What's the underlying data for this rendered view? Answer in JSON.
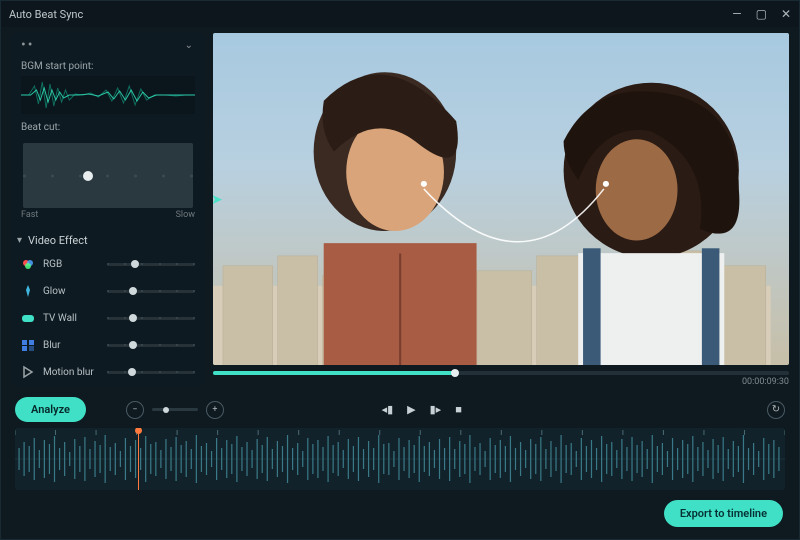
{
  "window": {
    "title": "Auto Beat Sync"
  },
  "bgm": {
    "label": "BGM start point:",
    "beat_cut_label": "Beat cut:",
    "beat_cut_min": "Fast",
    "beat_cut_max": "Slow",
    "beat_cut_value_pct": 38
  },
  "effects": {
    "section_label": "Video Effect",
    "items": [
      {
        "name": "RGB",
        "icon": "rgb-icon",
        "value_pct": 32
      },
      {
        "name": "Glow",
        "icon": "glow-icon",
        "value_pct": 30
      },
      {
        "name": "TV Wall",
        "icon": "tvwall-icon",
        "value_pct": 30
      },
      {
        "name": "Blur",
        "icon": "blur-icon",
        "value_pct": 30
      },
      {
        "name": "Motion blur",
        "icon": "motionblur-icon",
        "value_pct": 28
      }
    ]
  },
  "preview": {
    "progress_pct": 42,
    "timecode": "00:00:09:30"
  },
  "controls": {
    "analyze_label": "Analyze",
    "zoom_pct": 30
  },
  "timeline": {
    "playhead_pct": 16
  },
  "footer": {
    "export_label": "Export to timeline"
  },
  "colors": {
    "accent": "#3fe0c5",
    "playhead": "#ff7a3c"
  }
}
